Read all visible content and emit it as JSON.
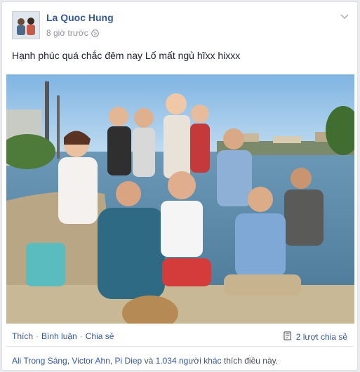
{
  "post": {
    "author": "La Quoc Hung",
    "timestamp": "8 giờ trước",
    "privacy_icon": "globe-icon",
    "text": "Hạnh phúc quá chắc đêm nay Lố mất ngủ hĩxx hixxx"
  },
  "actions": {
    "like": "Thích",
    "sep1": "·",
    "comment": "Bình luận",
    "sep2": "·",
    "share": "Chia sẻ",
    "shares_count": "2 lượt chia sẻ"
  },
  "likes": {
    "names": "Ali Trong Sáng, Victor Ahn, Pi Diep",
    "connector": "và",
    "others": "1.034 người khác",
    "suffix": "thích điều này."
  },
  "colors": {
    "link": "#365899",
    "meta": "#90949c",
    "sky": "#8fc0e8",
    "water": "#5f8fb0"
  }
}
